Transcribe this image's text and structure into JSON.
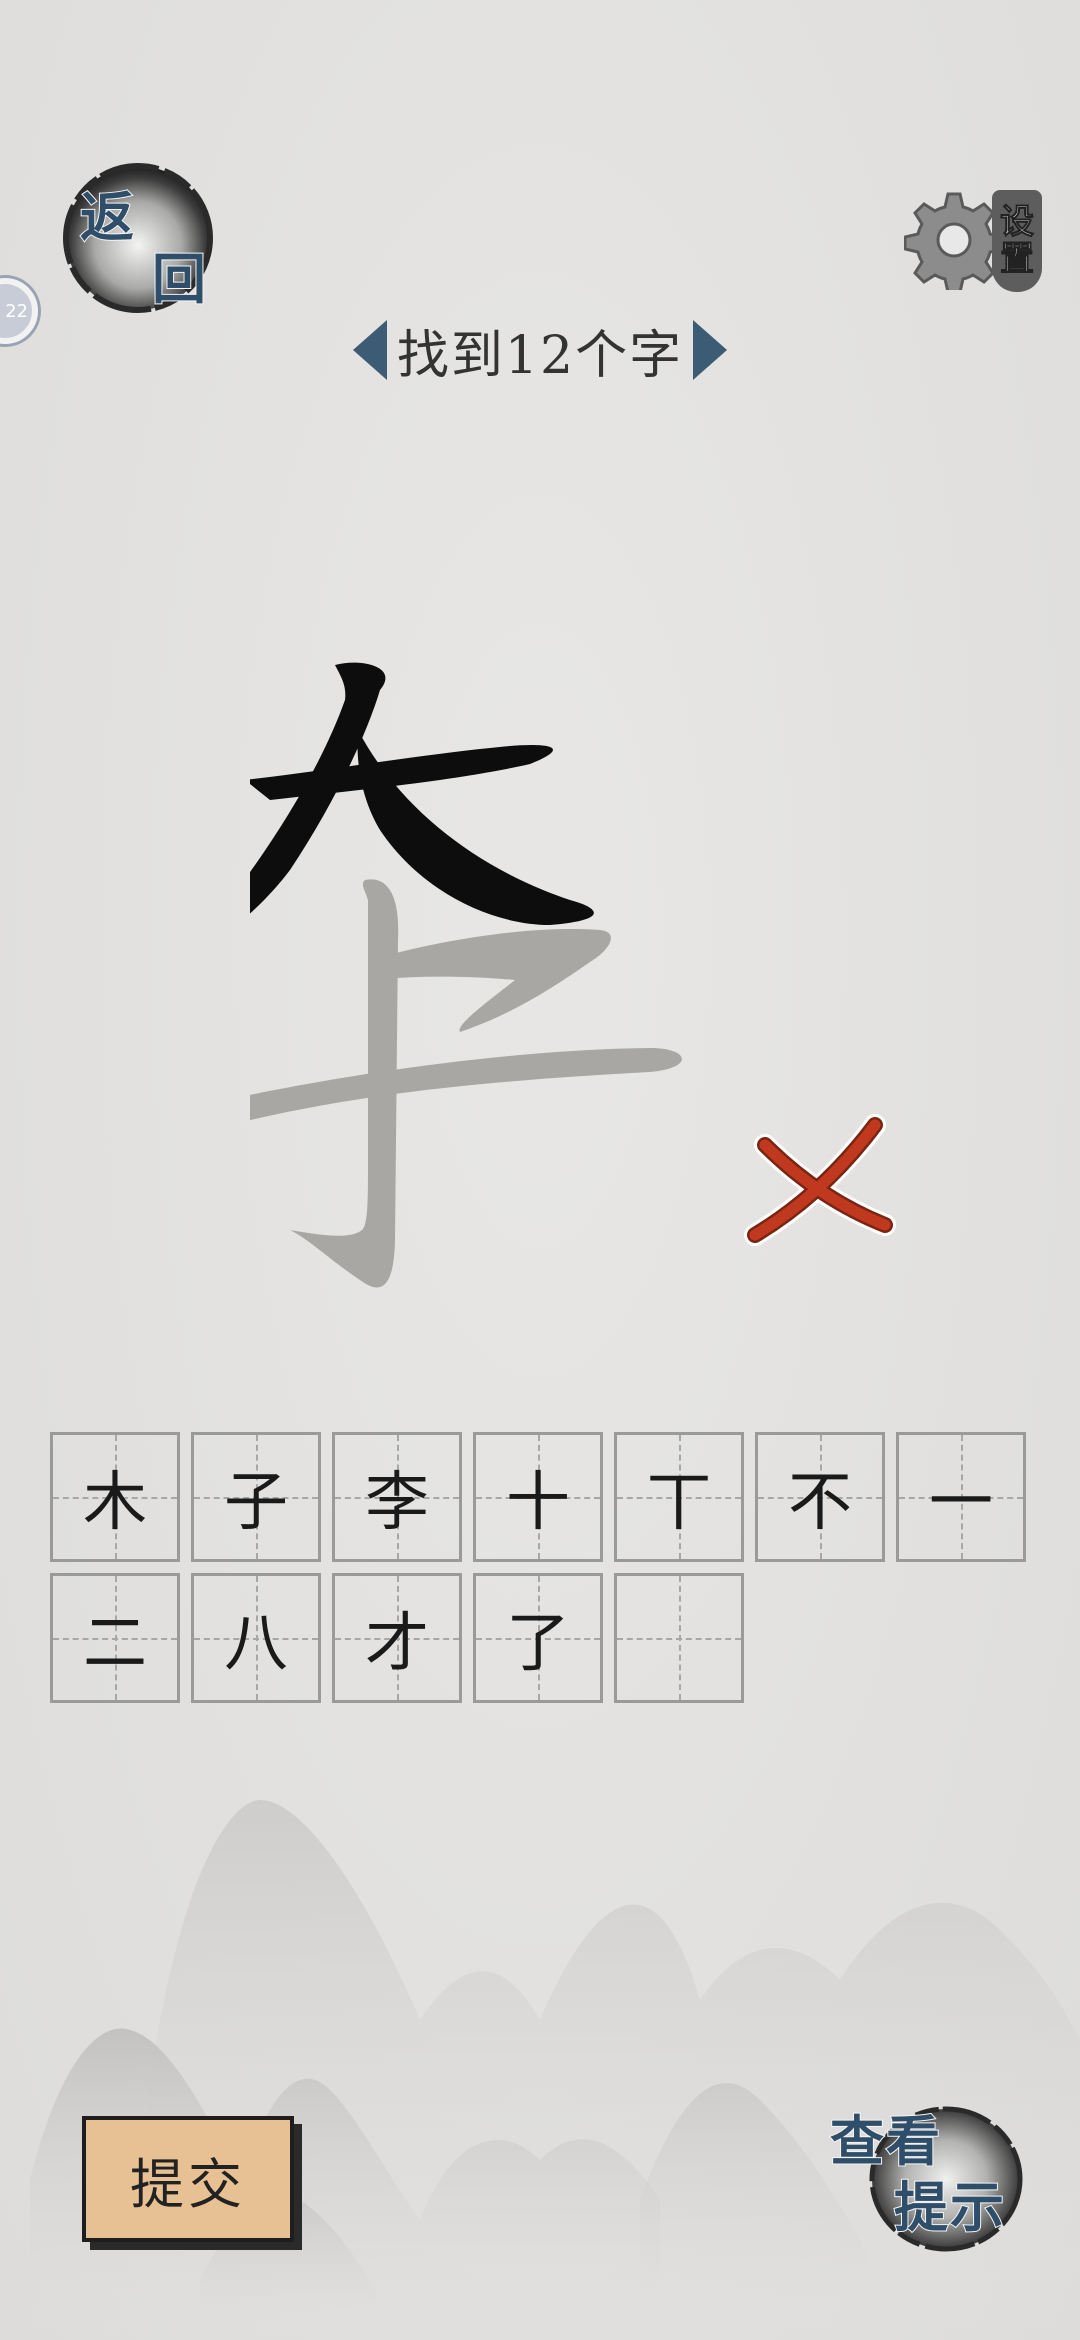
{
  "header": {
    "back_line1": "返",
    "back_line2": "回",
    "settings_line1": "设",
    "settings_line2": "置",
    "level_badge": "22"
  },
  "title": {
    "text": "找到12个字"
  },
  "main_character": "李",
  "grid": {
    "row1": [
      "木",
      "子",
      "李",
      "十",
      "丅",
      "不",
      "一"
    ],
    "row2": [
      "二",
      "八",
      "才",
      "了",
      ""
    ]
  },
  "footer": {
    "submit_label": "提交",
    "hint_line1": "查看",
    "hint_line2": "提示"
  },
  "colors": {
    "accent_blue": "#2f4e6a",
    "wrong_red": "#c0391f",
    "submit_bg": "#e7c193"
  },
  "icons": {
    "wrong": "cross-mark-icon",
    "settings": "gear-icon",
    "prev": "arrow-left-icon",
    "next": "arrow-right-icon"
  }
}
